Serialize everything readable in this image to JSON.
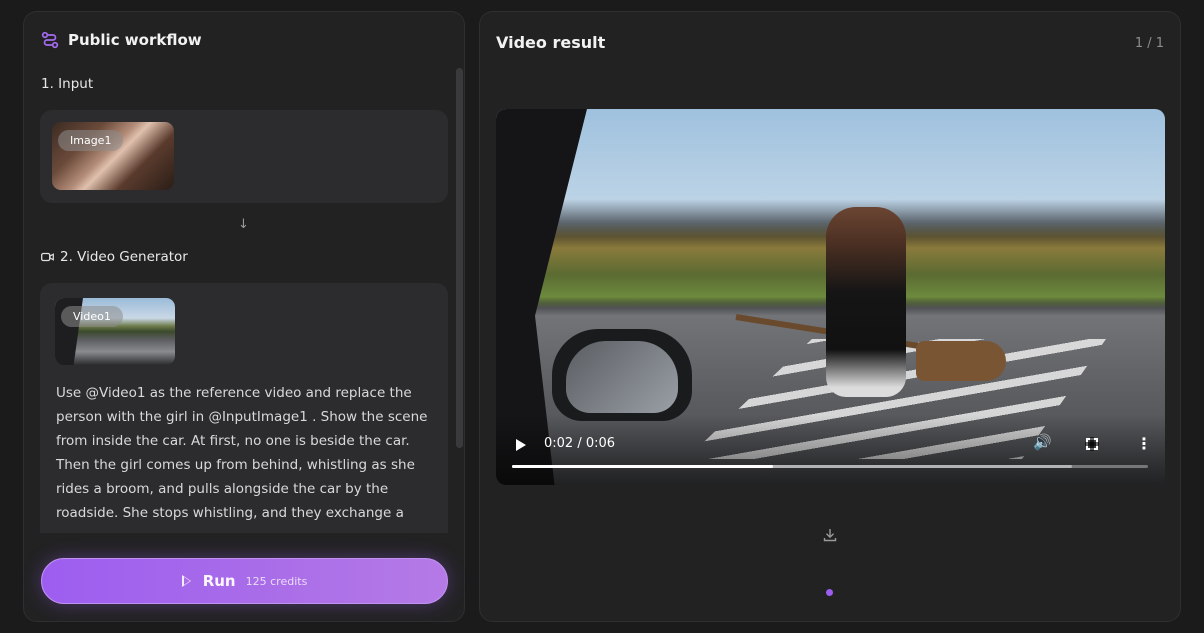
{
  "workflow": {
    "title": "Public workflow",
    "icon": "workflow-icon",
    "step1": {
      "label": "1. Input",
      "image_label": "Image1"
    },
    "step2": {
      "label": "2. Video Generator",
      "icon": "video-camera-icon",
      "video_label": "Video1",
      "prompt": "Use @Video1 as the reference video and replace the person with the girl in @InputImage1 . Show the scene from inside the car. At first, no one is beside the car. Then the girl comes up from behind, whistling as she rides a broom, and pulls alongside the car by the roadside. She stops whistling, and they exchange a"
    },
    "run_button": {
      "label": "Run",
      "credits": "125 credits"
    }
  },
  "result": {
    "title": "Video result",
    "counter": "1 / 1",
    "player": {
      "time": "0:02 / 0:06",
      "progress": 0.41,
      "buffered": 0.88
    }
  },
  "colors": {
    "accent": "#9d5ef0",
    "panel": "#222223",
    "background": "#1b1b1c"
  }
}
